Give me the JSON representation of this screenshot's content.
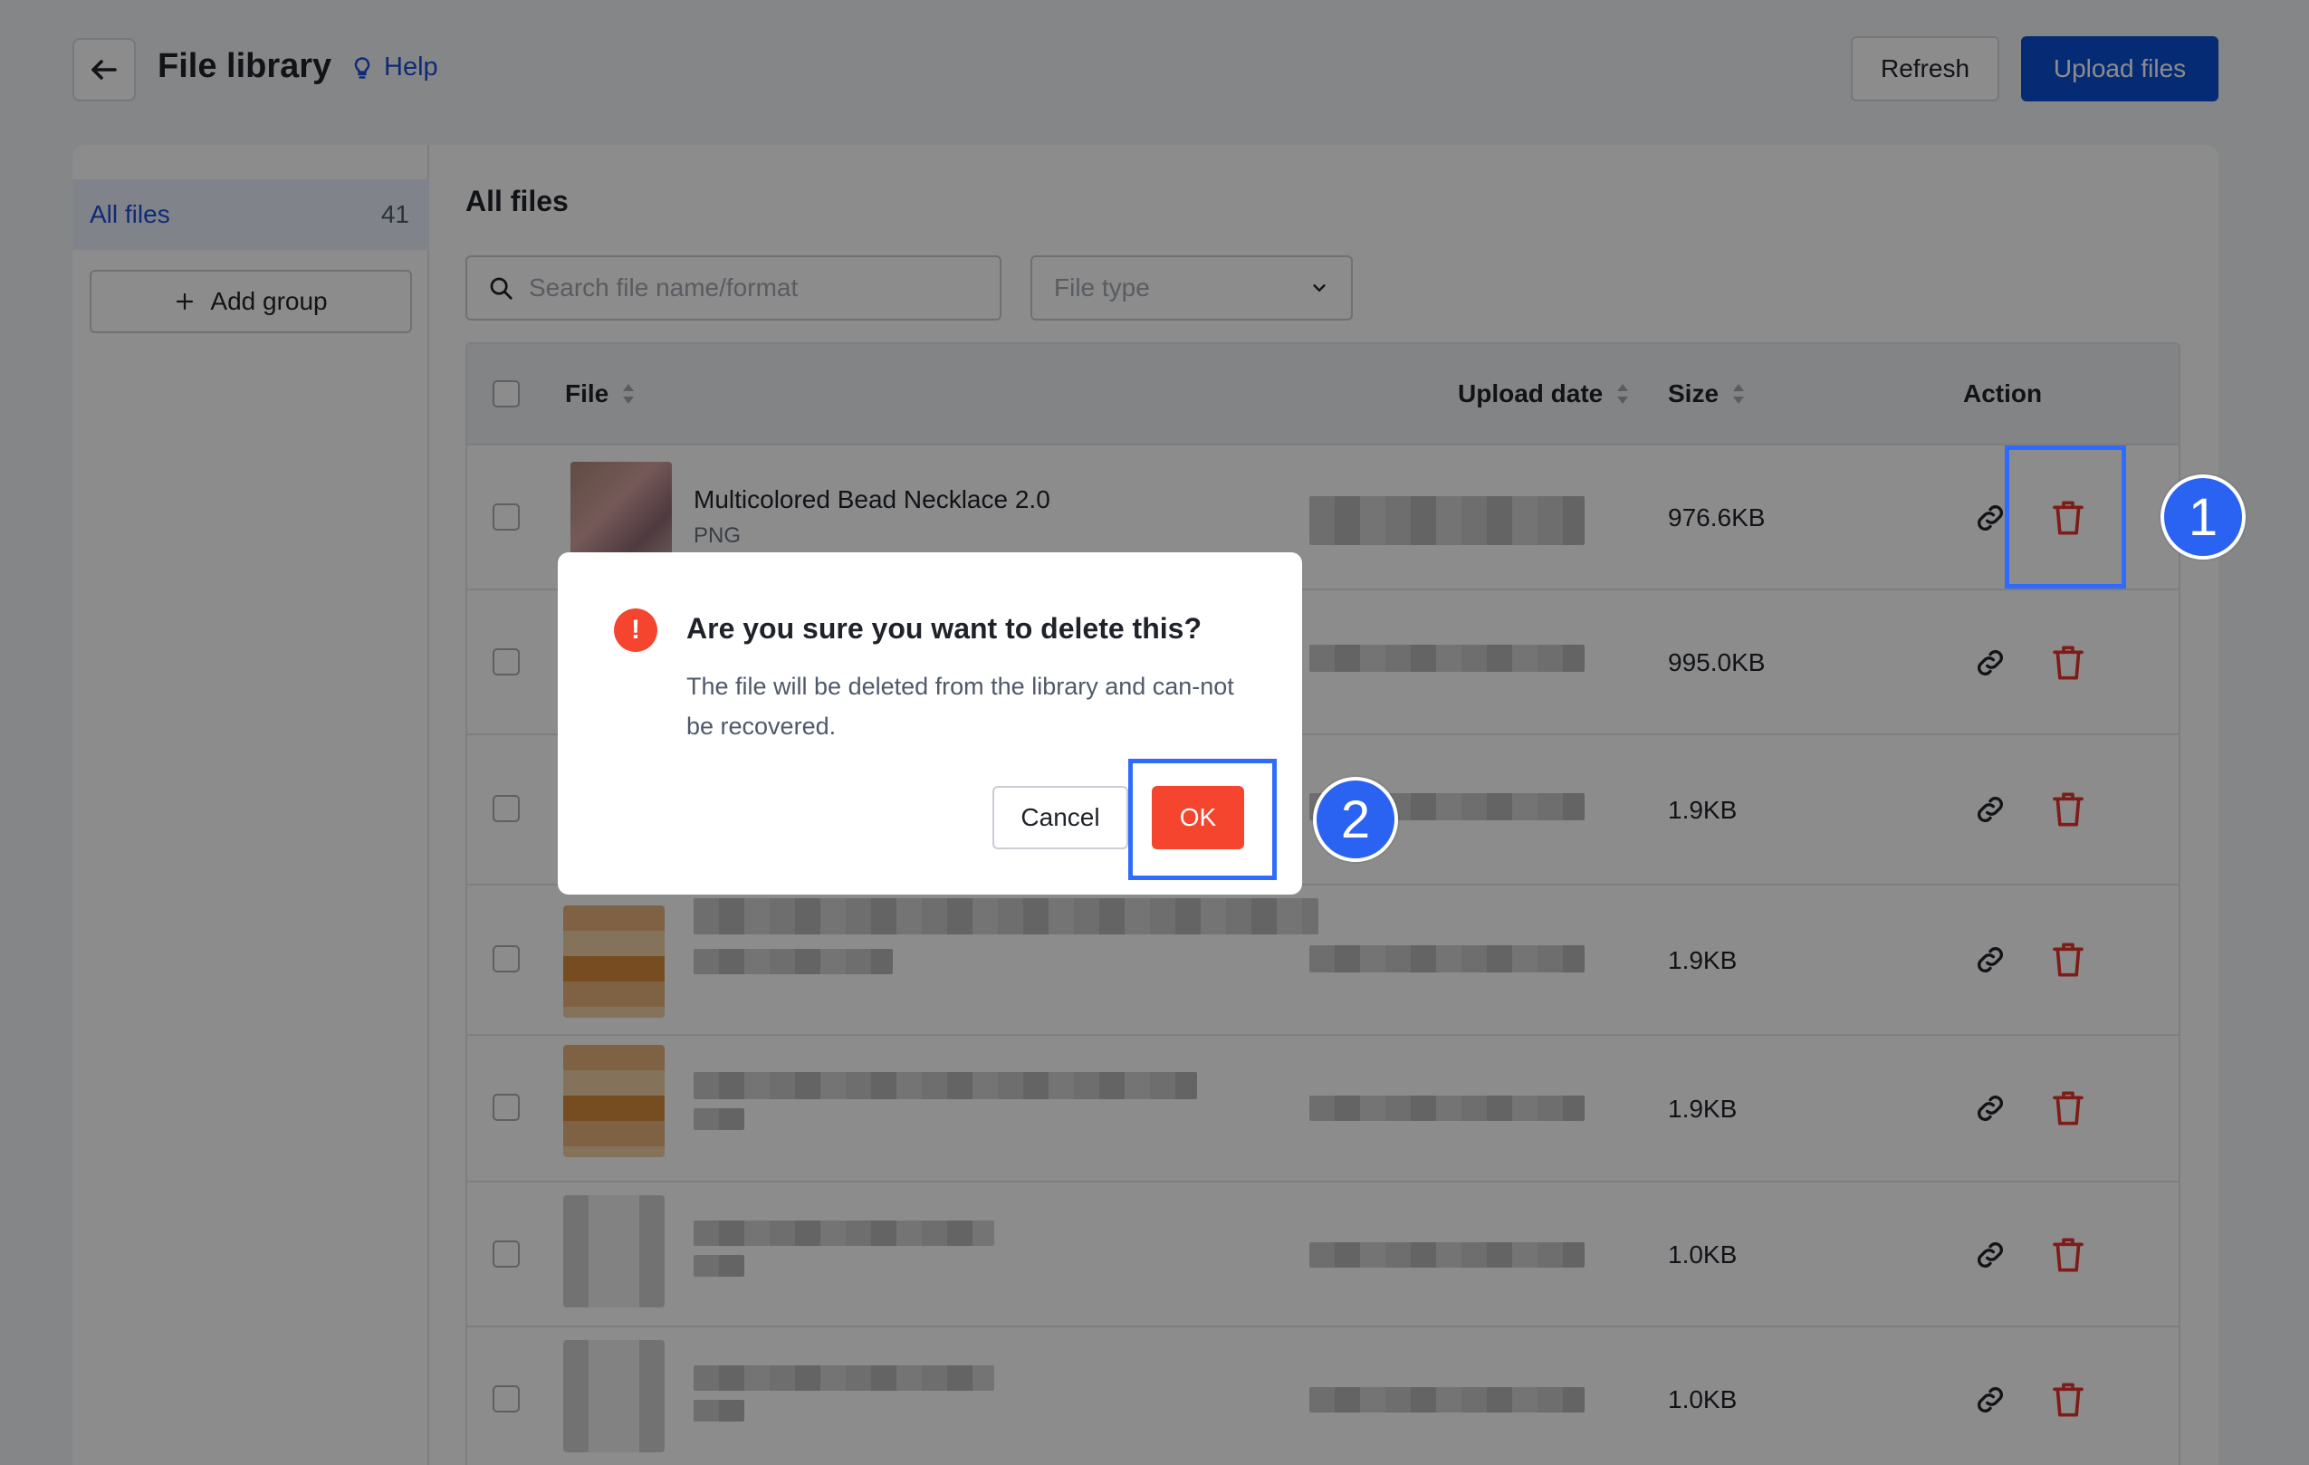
{
  "header": {
    "title": "File library",
    "help": "Help",
    "refresh": "Refresh",
    "upload": "Upload files"
  },
  "sidebar": {
    "all_files_label": "All files",
    "all_files_count": "41",
    "add_group": "Add group"
  },
  "main": {
    "title": "All files",
    "search_placeholder": "Search file name/format",
    "file_type_placeholder": "File type"
  },
  "table": {
    "columns": [
      "File",
      "Upload date",
      "Size",
      "Action"
    ],
    "rows": [
      {
        "name": "Multicolored Bead Necklace 2.0",
        "format": "PNG",
        "size": "976.6KB"
      },
      {
        "name": "",
        "format": "",
        "size": "995.0KB"
      },
      {
        "name": "",
        "format": "",
        "size": "1.9KB"
      },
      {
        "name": "",
        "format": "",
        "size": "1.9KB"
      },
      {
        "name": "",
        "format": "",
        "size": "1.9KB"
      },
      {
        "name": "",
        "format": "",
        "size": "1.0KB"
      },
      {
        "name": "",
        "format": "",
        "size": "1.0KB"
      }
    ]
  },
  "dialog": {
    "title": "Are you sure you want to delete this?",
    "body": "The file will be deleted from the library and can-not be recovered.",
    "cancel": "Cancel",
    "ok": "OK",
    "icon_text": "!"
  },
  "steps": [
    "1",
    "2"
  ],
  "colors": {
    "primary": "#0b4fd6",
    "danger": "#f5452e",
    "highlight": "#2f6bff"
  },
  "icons": {
    "back": "arrow-left-icon",
    "help": "lightbulb-icon",
    "add": "plus-icon",
    "search": "search-icon",
    "dropdown": "chevron-down-icon",
    "sort": "sort-icon",
    "link": "link-icon",
    "delete": "trash-icon",
    "warning": "exclamation-icon"
  }
}
